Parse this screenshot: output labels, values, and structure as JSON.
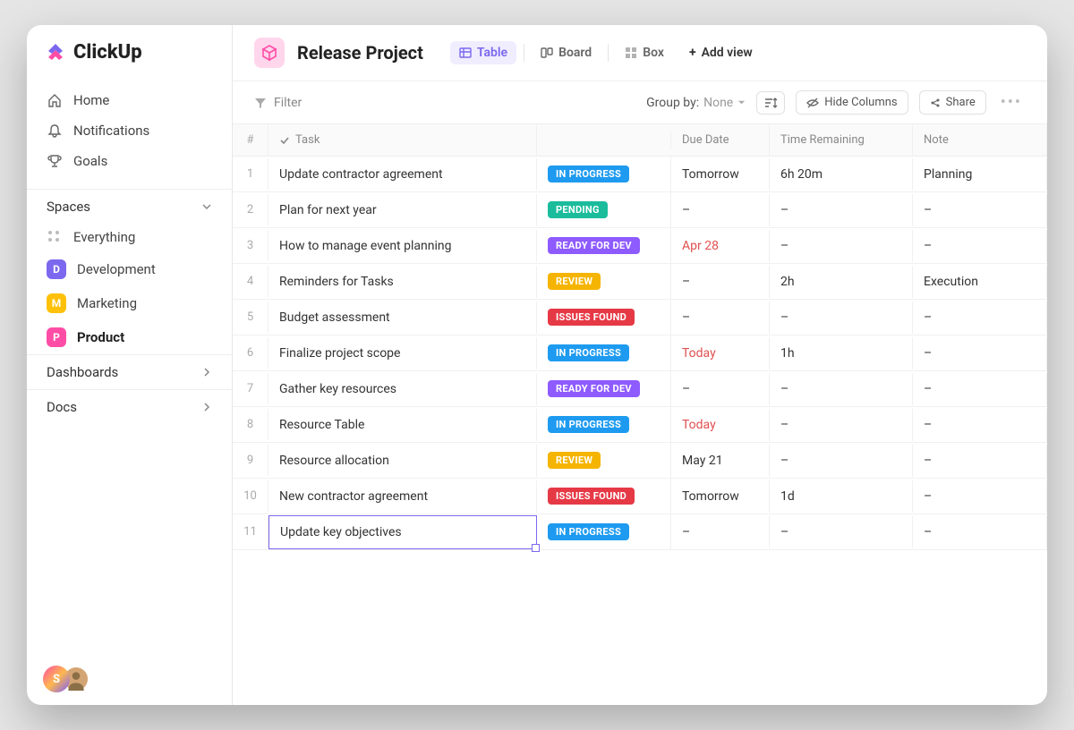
{
  "logo_text": "ClickUp",
  "nav": [
    {
      "label": "Home",
      "icon": "home"
    },
    {
      "label": "Notifications",
      "icon": "bell"
    },
    {
      "label": "Goals",
      "icon": "trophy"
    }
  ],
  "spaces_label": "Spaces",
  "everything_label": "Everything",
  "spaces": [
    {
      "letter": "D",
      "label": "Development",
      "color": "#7b68ee"
    },
    {
      "letter": "M",
      "label": "Marketing",
      "color": "#ffc107"
    },
    {
      "letter": "P",
      "label": "Product",
      "color": "#ff4da6",
      "active": true
    }
  ],
  "sections": [
    {
      "label": "Dashboards"
    },
    {
      "label": "Docs"
    }
  ],
  "user_initial": "S",
  "project": {
    "title": "Release Project"
  },
  "views": [
    {
      "label": "Table",
      "active": true,
      "icon": "table"
    },
    {
      "label": "Board",
      "icon": "board"
    },
    {
      "label": "Box",
      "icon": "box"
    }
  ],
  "add_view_label": "Add view",
  "toolbar": {
    "filter_label": "Filter",
    "group_by_label": "Group by:",
    "group_by_value": "None",
    "hide_columns_label": "Hide Columns",
    "share_label": "Share"
  },
  "columns": {
    "num": "#",
    "task": "Task",
    "due": "Due Date",
    "time": "Time Remaining",
    "note": "Note"
  },
  "status_colors": {
    "IN PROGRESS": "#1e9bf0",
    "PENDING": "#1abc9c",
    "READY FOR DEV": "#8e5bff",
    "REVIEW": "#f5b400",
    "ISSUES FOUND": "#e63946"
  },
  "rows": [
    {
      "n": 1,
      "task": "Update contractor agreement",
      "status": "IN PROGRESS",
      "due": "Tomorrow",
      "due_red": false,
      "time": "6h 20m",
      "note": "Planning"
    },
    {
      "n": 2,
      "task": "Plan for next year",
      "status": "PENDING",
      "due": "–",
      "due_red": false,
      "time": "–",
      "note": "–"
    },
    {
      "n": 3,
      "task": "How to manage event planning",
      "status": "READY FOR DEV",
      "due": "Apr 28",
      "due_red": true,
      "time": "–",
      "note": "–"
    },
    {
      "n": 4,
      "task": "Reminders for Tasks",
      "status": "REVIEW",
      "due": "–",
      "due_red": false,
      "time": "2h",
      "note": "Execution"
    },
    {
      "n": 5,
      "task": "Budget assessment",
      "status": "ISSUES FOUND",
      "due": "–",
      "due_red": false,
      "time": "–",
      "note": "–"
    },
    {
      "n": 6,
      "task": "Finalize project scope",
      "status": "IN PROGRESS",
      "due": "Today",
      "due_red": true,
      "time": "1h",
      "note": "–"
    },
    {
      "n": 7,
      "task": "Gather key resources",
      "status": "READY FOR DEV",
      "due": "–",
      "due_red": false,
      "time": "–",
      "note": "–"
    },
    {
      "n": 8,
      "task": "Resource Table",
      "status": "IN PROGRESS",
      "due": "Today",
      "due_red": true,
      "time": "–",
      "note": "–"
    },
    {
      "n": 9,
      "task": "Resource allocation",
      "status": "REVIEW",
      "due": "May 21",
      "due_red": false,
      "time": "–",
      "note": "–"
    },
    {
      "n": 10,
      "task": "New contractor agreement",
      "status": "ISSUES FOUND",
      "due": "Tomorrow",
      "due_red": false,
      "time": "1d",
      "note": "–"
    },
    {
      "n": 11,
      "task": "Update key objectives",
      "status": "IN PROGRESS",
      "due": "–",
      "due_red": false,
      "time": "–",
      "note": "–",
      "editing": true
    }
  ]
}
